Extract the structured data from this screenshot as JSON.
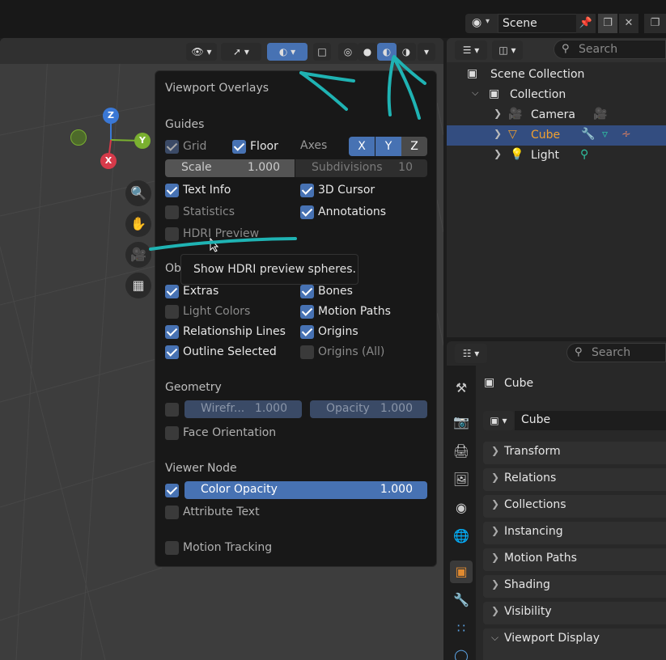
{
  "topbar": {
    "scene_label": "Scene",
    "scene_icon": "scene-icon",
    "pin_icon": "pin-icon",
    "copy_icon": "copy-icon",
    "close_icon": "close-icon"
  },
  "viewport": {
    "header_icons": [
      "view-object-icon",
      "gizmo-icon",
      "overlays-icon",
      "xray-icon",
      "wireframe-shading-icon",
      "solid-shading-icon",
      "material-shading-icon",
      "rendered-shading-icon"
    ],
    "gizmo": {
      "z": "Z",
      "y": "Y",
      "x": "X"
    },
    "tools": [
      "zoom-icon",
      "hand-icon",
      "camera-icon",
      "grid-icon"
    ]
  },
  "overlays": {
    "title": "Viewport Overlays",
    "guides": {
      "header": "Guides",
      "grid": "Grid",
      "floor": "Floor",
      "axes": "Axes",
      "axis_x": "X",
      "axis_y": "Y",
      "axis_z": "Z",
      "scale_label": "Scale",
      "scale_value": "1.000",
      "subdivisions_label": "Subdivisions",
      "subdivisions_value": "10",
      "text_info": "Text Info",
      "cursor_3d": "3D Cursor",
      "statistics": "Statistics",
      "annotations": "Annotations",
      "hdri_preview": "HDRI Preview"
    },
    "objects": {
      "header": "Ob",
      "extras": "Extras",
      "bones": "Bones",
      "light_colors": "Light Colors",
      "motion_paths": "Motion Paths",
      "relationship_lines": "Relationship Lines",
      "origins": "Origins",
      "outline_selected": "Outline Selected",
      "origins_all": "Origins (All)"
    },
    "geometry": {
      "header": "Geometry",
      "wireframe_label": "Wirefr...",
      "wireframe_value": "1.000",
      "opacity_label": "Opacity",
      "opacity_value": "1.000",
      "face_orientation": "Face Orientation"
    },
    "viewer_node": {
      "header": "Viewer Node",
      "color_opacity_label": "Color Opacity",
      "color_opacity_value": "1.000",
      "attribute_text": "Attribute Text"
    },
    "motion_tracking": "Motion Tracking",
    "tooltip": "Show HDRI preview spheres."
  },
  "outliner": {
    "search_placeholder": "Search",
    "scene_collection": "Scene Collection",
    "collection": "Collection",
    "items": [
      {
        "name": "Camera"
      },
      {
        "name": "Cube"
      },
      {
        "name": "Light"
      }
    ]
  },
  "properties": {
    "search_placeholder": "Search",
    "object_name": "Cube",
    "data_name": "Cube",
    "panels": [
      "Transform",
      "Relations",
      "Collections",
      "Instancing",
      "Motion Paths",
      "Shading",
      "Visibility",
      "Viewport Display"
    ]
  },
  "colors": {
    "accent": "#4772b3",
    "annotation_pen": "#1fb3b3",
    "selected_row": "#334d80",
    "active_object_text": "#f0a030"
  }
}
